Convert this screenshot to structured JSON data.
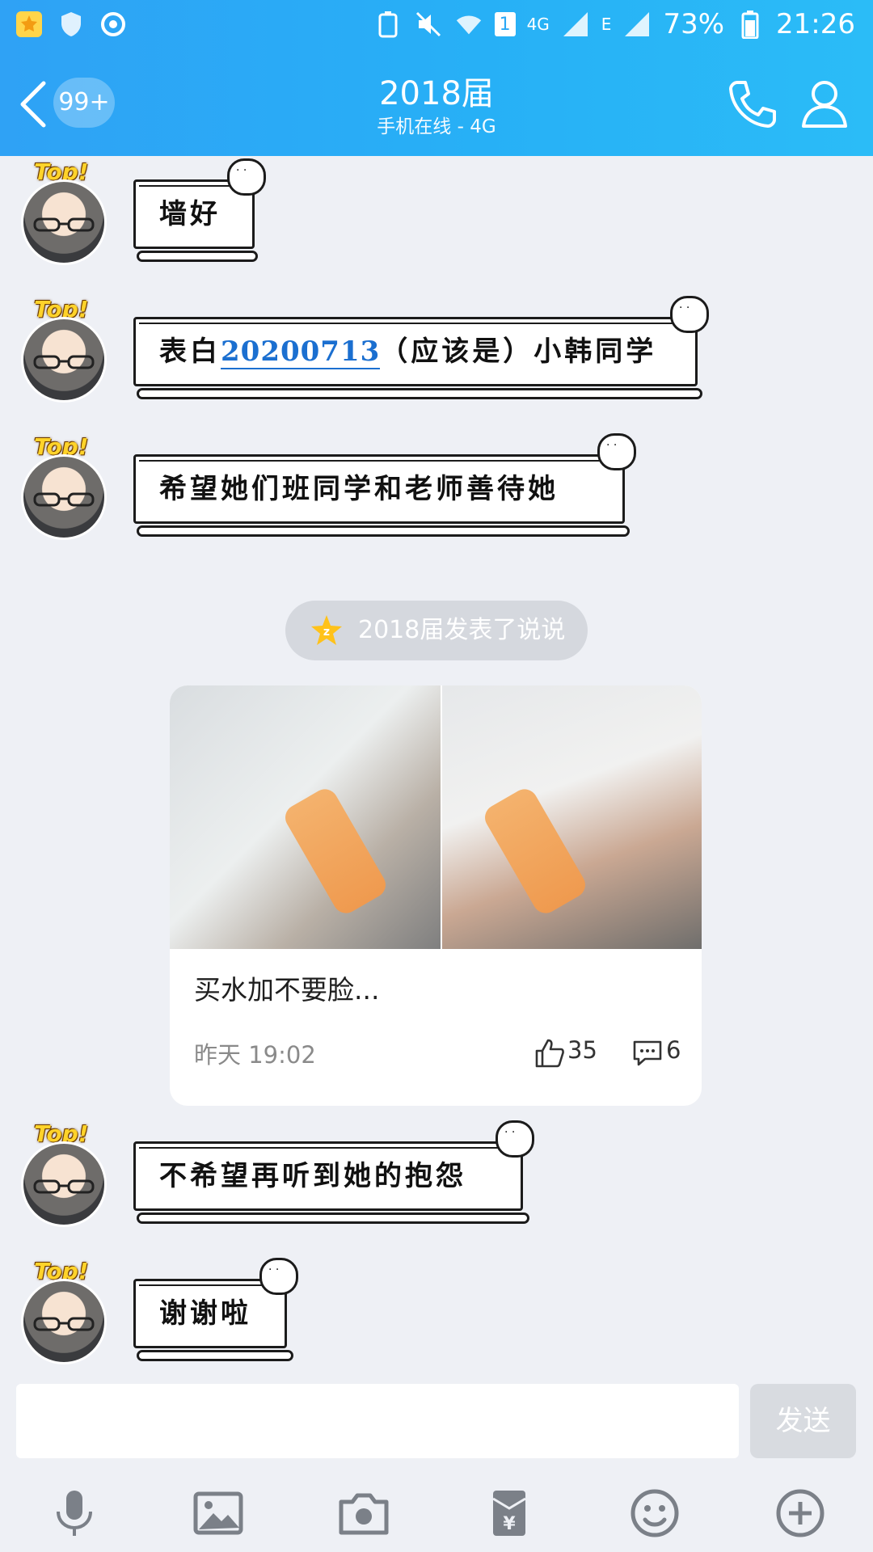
{
  "status_bar": {
    "battery_percent": "73%",
    "time": "21:26",
    "network": "4G",
    "network2": "E",
    "sim": "1"
  },
  "header": {
    "unread_badge": "99+",
    "title": "2018届",
    "subtitle": "手机在线 - 4G"
  },
  "messages": [
    {
      "badge": "Top!",
      "text": "墙好"
    },
    {
      "badge": "Top!",
      "text_before": "表白",
      "link": "20200713",
      "text_after": "（应该是）小韩同学"
    },
    {
      "badge": "Top!",
      "text": "希望她们班同学和老师善待她"
    },
    {
      "badge": "Top!",
      "text": "不希望再听到她的抱怨"
    },
    {
      "badge": "Top!",
      "text": "谢谢啦"
    }
  ],
  "system_notice": "2018届发表了说说",
  "post_card": {
    "caption": "买水加不要脸...",
    "time": "昨天 19:02",
    "likes": "35",
    "comments": "6"
  },
  "input": {
    "send_label": "发送"
  },
  "toolbar_icons": [
    "microphone-icon",
    "image-icon",
    "camera-icon",
    "red-packet-icon",
    "emoji-icon",
    "plus-icon"
  ],
  "colors": {
    "header_blue": "#2aa8f6",
    "link_blue": "#1b6fd0",
    "background": "#eef0f5"
  }
}
